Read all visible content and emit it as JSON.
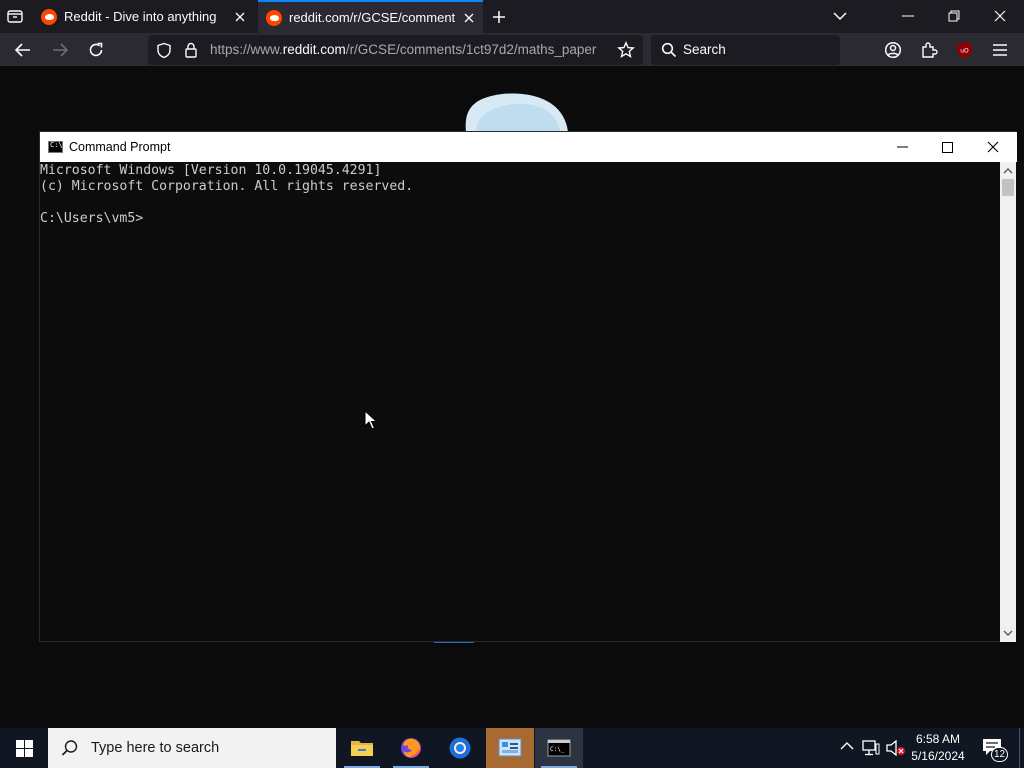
{
  "browser": {
    "tabs": [
      {
        "title": "Reddit - Dive into anything",
        "active": false
      },
      {
        "title": "reddit.com/r/GCSE/comments/",
        "active": true
      }
    ],
    "url": {
      "prefix": "https://www.",
      "domain": "reddit.com",
      "path": "/r/GCSE/comments/1ct97d2/maths_paper"
    },
    "search_placeholder": "Search",
    "accent_color": "#0a84ff"
  },
  "cmd": {
    "title": "Command Prompt",
    "console_text": "Microsoft Windows [Version 10.0.19045.4291]\n(c) Microsoft Corporation. All rights reserved.\n\nC:\\Users\\vm5>"
  },
  "taskbar": {
    "search_placeholder": "Type here to search",
    "apps": [
      "file-explorer-icon",
      "firefox-icon",
      "chrome-icon",
      "control-panel-icon",
      "command-prompt-icon"
    ],
    "time": "6:58 AM",
    "date": "5/16/2024",
    "notification_count": "12"
  }
}
